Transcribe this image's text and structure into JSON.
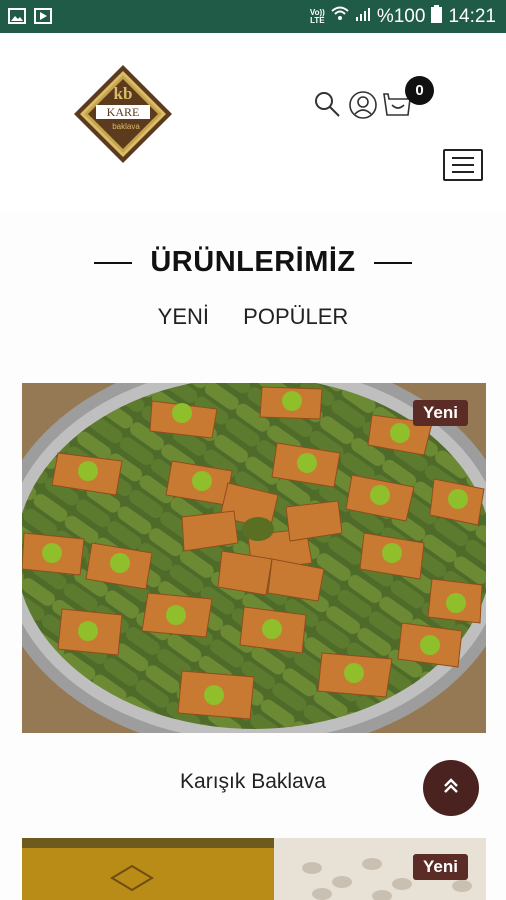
{
  "status_bar": {
    "carrier_top": "Vo))",
    "carrier_bottom": "LTE",
    "battery_percent": "%100",
    "time": "14:21",
    "icons": [
      "image-icon",
      "play-icon",
      "wifi-icon",
      "signal-icon",
      "battery-icon"
    ]
  },
  "header": {
    "logo_mark": "kb",
    "logo_word": "KARE",
    "logo_sub": "baklava",
    "cart_count": "0",
    "icons": [
      "search-icon",
      "user-icon",
      "cart-icon",
      "menu-icon"
    ]
  },
  "products_section": {
    "title": "ÜRÜNLERİMİZ",
    "tabs": [
      "YENİ",
      "POPÜLER"
    ]
  },
  "products": [
    {
      "name": "Karışık Baklava",
      "badge": "Yeni"
    },
    {
      "name": "",
      "badge": "Yeni"
    }
  ],
  "colors": {
    "status_bar": "#1f5b47",
    "badge": "#5b2c26",
    "fab": "#4a2320",
    "logo_brown": "#5b3a1e",
    "logo_gold": "#c7a44a"
  }
}
